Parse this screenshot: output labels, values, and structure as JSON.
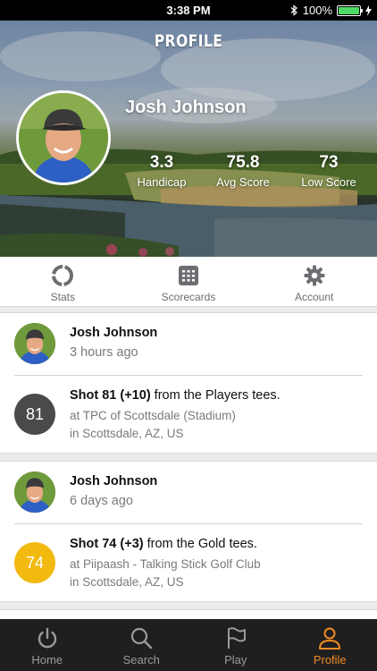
{
  "status_bar": {
    "time": "3:38 PM",
    "battery_percent": "100%",
    "bluetooth_icon": "bluetooth-icon",
    "charging_icon": "bolt-icon"
  },
  "header": {
    "title": "PROFILE"
  },
  "profile": {
    "name": "Josh Johnson",
    "stats": [
      {
        "value": "3.3",
        "label": "Handicap"
      },
      {
        "value": "75.8",
        "label": "Avg Score"
      },
      {
        "value": "73",
        "label": "Low Score"
      }
    ]
  },
  "tabs": [
    {
      "label": "Stats",
      "icon": "stats-icon"
    },
    {
      "label": "Scorecards",
      "icon": "scorecard-icon"
    },
    {
      "label": "Account",
      "icon": "gear-icon"
    }
  ],
  "feed": [
    {
      "name": "Josh Johnson",
      "time": "3 hours ago",
      "score": "81",
      "score_color": "#4a4a4a",
      "shot_strong": "Shot 81 (+10)",
      "shot_rest": " from the Players tees.",
      "course": "at TPC of Scottsdale (Stadium)",
      "location": "in Scottsdale, AZ, US"
    },
    {
      "name": "Josh Johnson",
      "time": "6 days ago",
      "score": "74",
      "score_color": "#f2b90f",
      "shot_strong": "Shot 74 (+3)",
      "shot_rest": " from the Gold tees.",
      "course": "at Piipaash - Talking Stick Golf Club",
      "location": "in Scottsdale, AZ, US"
    }
  ],
  "bottom_nav": [
    {
      "label": "Home",
      "icon": "home-power-icon",
      "active": false
    },
    {
      "label": "Search",
      "icon": "search-icon",
      "active": false
    },
    {
      "label": "Play",
      "icon": "flag-icon",
      "active": false
    },
    {
      "label": "Profile",
      "icon": "person-icon",
      "active": true
    }
  ],
  "colors": {
    "accent": "#f08a24",
    "nav_bg": "#1f1f1f",
    "battery": "#4cd964"
  }
}
